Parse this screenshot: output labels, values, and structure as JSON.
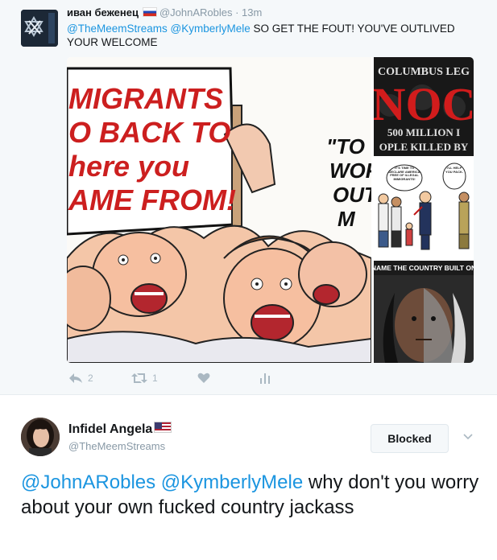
{
  "tweet": {
    "display_name": "иван беженец",
    "handle": "@JohnARobles",
    "time": "13m",
    "mentions": [
      "@TheMeemStreams",
      "@KymberlyMele"
    ],
    "body": " SO GET THE FOUT! YOU'VE OUTLIVED YOUR WELCOME",
    "flag_icon": "russia-flag-icon",
    "actions": {
      "reply_count": "2",
      "retweet_count": "1"
    },
    "media": {
      "main": {
        "sign_lines": [
          "MIGRANTS",
          "O BACK TO",
          "here you",
          "AME FROM!"
        ],
        "speech_lines": [
          "\"TO",
          "WOR",
          "OUT",
          "M"
        ]
      },
      "thumb1": {
        "lines": [
          "COLUMBUS LEG",
          "NOC",
          "500 MILLION I",
          "OPLE KILLED BY"
        ]
      },
      "thumb2": {
        "bubble_left": "IT'S TIME TO DECLARE AMERICA FREE OF ILLEGAL IMMIGRANTS!",
        "bubble_right": "I'LL HELP YOU PACK."
      },
      "thumb3": {
        "title": "NAME THE COUNTRY BUILT ON"
      }
    }
  },
  "reply": {
    "display_name": "Infidel Angela",
    "handle": "@TheMeemStreams",
    "flag_icon": "usa-flag-icon",
    "blocked_label": "Blocked",
    "mentions": [
      "@JohnARobles",
      "@KymberlyMele"
    ],
    "body": " why don't you worry about your own fucked country jackass"
  },
  "colors": {
    "link": "#1b95e0",
    "muted": "#8899a6",
    "action_icon": "#aab8c2",
    "background_top": "#f5f8fa"
  }
}
